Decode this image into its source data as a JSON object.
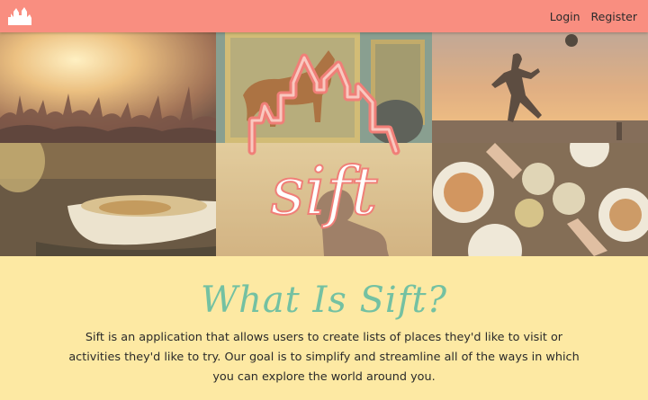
{
  "nav": {
    "logo_icon": "castle-logo-icon",
    "login_label": "Login",
    "register_label": "Register",
    "bar_color": "#f98e80"
  },
  "hero": {
    "logo_text": "sift",
    "logo_icon": "castle-outline-icon",
    "tiles": [
      "concert-crowd-photo",
      "horse-painting-photo",
      "silhouette-soccer-photo",
      "pasta-bowl-photo",
      "woman-silhouette-photo",
      "dinner-toast-photo"
    ]
  },
  "about": {
    "title": "What Is Sift?",
    "body": "Sift is an application that allows users to create lists of places they'd like to visit or activities they'd like to try. Our goal is to simplify and streamline all of the ways in which you can explore the world around you.",
    "title_color": "#74c1a2",
    "background_color": "#fde9a3"
  }
}
